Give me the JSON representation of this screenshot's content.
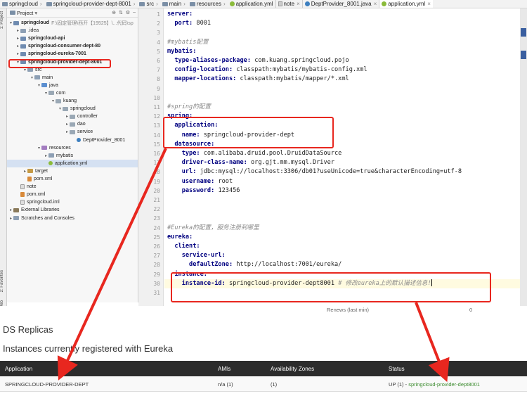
{
  "breadcrumb": [
    "springcloud",
    "springcloud-provider-dept-8001",
    "src",
    "main",
    "resources",
    "application.yml"
  ],
  "tabs": [
    {
      "label": "note",
      "icon": "note-icon"
    },
    {
      "label": "DeptProvider_8001.java",
      "icon": "java-icon"
    },
    {
      "label": "application.yml",
      "icon": "yml-icon",
      "active": true
    }
  ],
  "toolstrip": {
    "project": "1: Project",
    "favorites": "2: Favorites",
    "web": "Web"
  },
  "project_panel": {
    "title": "Project",
    "tree": [
      {
        "label": "springcloud",
        "path": "F:\\固定管理\\西开【19525】\\...代码\\sp",
        "depth": 0,
        "icon": "module",
        "bold": true,
        "arrow": "▾"
      },
      {
        "label": ".idea",
        "depth": 1,
        "icon": "folder",
        "arrow": "▸"
      },
      {
        "label": "springcloud-api",
        "depth": 1,
        "icon": "module",
        "bold": true,
        "arrow": "▸"
      },
      {
        "label": "springcloud-consumer-dept-80",
        "depth": 1,
        "icon": "module",
        "bold": true,
        "arrow": "▸"
      },
      {
        "label": "springcloud-eureka-7001",
        "depth": 1,
        "icon": "module",
        "bold": true,
        "arrow": "▸"
      },
      {
        "label": "springcloud-provider-dept-8001",
        "depth": 1,
        "icon": "module",
        "bold": true,
        "arrow": "▾"
      },
      {
        "label": "src",
        "depth": 2,
        "icon": "folder",
        "arrow": "▾"
      },
      {
        "label": "main",
        "depth": 3,
        "icon": "folder",
        "arrow": "▾"
      },
      {
        "label": "java",
        "depth": 4,
        "icon": "src",
        "arrow": "▾"
      },
      {
        "label": "com",
        "depth": 5,
        "icon": "pkg",
        "arrow": "▾"
      },
      {
        "label": "kuang",
        "depth": 6,
        "icon": "pkg",
        "arrow": "▾"
      },
      {
        "label": "springcloud",
        "depth": 7,
        "icon": "pkg",
        "arrow": "▾"
      },
      {
        "label": "controller",
        "depth": 8,
        "icon": "pkg",
        "arrow": "▸"
      },
      {
        "label": "dao",
        "depth": 8,
        "icon": "pkg",
        "arrow": "▸"
      },
      {
        "label": "service",
        "depth": 8,
        "icon": "pkg",
        "arrow": "▸"
      },
      {
        "label": "DeptProvider_8001",
        "depth": 9,
        "icon": "java",
        "arrow": ""
      },
      {
        "label": "resources",
        "depth": 4,
        "icon": "res",
        "arrow": "▾"
      },
      {
        "label": "mybatis",
        "depth": 5,
        "icon": "folder",
        "arrow": "▸"
      },
      {
        "label": "application.yml",
        "depth": 5,
        "icon": "yml",
        "arrow": "",
        "selected": true
      },
      {
        "label": "target",
        "depth": 2,
        "icon": "target",
        "arrow": "▸"
      },
      {
        "label": "pom.xml",
        "depth": 2,
        "icon": "xml",
        "arrow": ""
      },
      {
        "label": "note",
        "depth": 1,
        "icon": "file",
        "arrow": ""
      },
      {
        "label": "pom.xml",
        "depth": 1,
        "icon": "xml",
        "arrow": ""
      },
      {
        "label": "springcloud.iml",
        "depth": 1,
        "icon": "file",
        "arrow": ""
      },
      {
        "label": "External Libraries",
        "depth": 0,
        "icon": "lib",
        "arrow": "▸"
      },
      {
        "label": "Scratches and Consoles",
        "depth": 0,
        "icon": "folder",
        "arrow": "▸"
      }
    ]
  },
  "editor": {
    "lines": [
      {
        "n": "1",
        "parts": [
          {
            "t": "server:",
            "c": "k"
          }
        ]
      },
      {
        "n": "2",
        "parts": [
          {
            "t": "  port: ",
            "c": "k"
          },
          {
            "t": "8001",
            "c": "v"
          }
        ]
      },
      {
        "n": "3",
        "parts": []
      },
      {
        "n": "4",
        "parts": [
          {
            "t": "#mybatis配置",
            "c": "c"
          }
        ]
      },
      {
        "n": "5",
        "parts": [
          {
            "t": "mybatis:",
            "c": "k"
          }
        ]
      },
      {
        "n": "6",
        "parts": [
          {
            "t": "  type-aliases-package: ",
            "c": "k"
          },
          {
            "t": "com.kuang.springcloud.pojo",
            "c": "v"
          }
        ]
      },
      {
        "n": "7",
        "parts": [
          {
            "t": "  config-location: ",
            "c": "k"
          },
          {
            "t": "classpath:mybatis/mybatis-config.xml",
            "c": "v"
          }
        ]
      },
      {
        "n": "8",
        "parts": [
          {
            "t": "  mapper-locations: ",
            "c": "k"
          },
          {
            "t": "classpath:mybatis/mapper/*.xml",
            "c": "v"
          }
        ]
      },
      {
        "n": "9",
        "parts": []
      },
      {
        "n": "10",
        "parts": []
      },
      {
        "n": "11",
        "parts": [
          {
            "t": "#spring的配置",
            "c": "c"
          }
        ]
      },
      {
        "n": "12",
        "parts": [
          {
            "t": "spring:",
            "c": "k"
          }
        ]
      },
      {
        "n": "13",
        "parts": [
          {
            "t": "  application:",
            "c": "k"
          }
        ]
      },
      {
        "n": "14",
        "parts": [
          {
            "t": "    name: ",
            "c": "k"
          },
          {
            "t": "springcloud-provider-dept",
            "c": "v"
          }
        ]
      },
      {
        "n": "15",
        "parts": [
          {
            "t": "  datasource:",
            "c": "k"
          }
        ]
      },
      {
        "n": "16",
        "parts": [
          {
            "t": "    type: ",
            "c": "k"
          },
          {
            "t": "com.alibaba.druid.pool.DruidDataSource",
            "c": "v"
          }
        ]
      },
      {
        "n": "17",
        "parts": [
          {
            "t": "    driver-class-name: ",
            "c": "k"
          },
          {
            "t": "org.gjt.mm.mysql.Driver",
            "c": "v"
          }
        ]
      },
      {
        "n": "18",
        "parts": [
          {
            "t": "    url: ",
            "c": "k"
          },
          {
            "t": "jdbc:mysql://localhost:3306/db01?useUnicode=true&characterEncoding=utf-8",
            "c": "v"
          }
        ]
      },
      {
        "n": "19",
        "parts": [
          {
            "t": "    username: ",
            "c": "k"
          },
          {
            "t": "root",
            "c": "v"
          }
        ]
      },
      {
        "n": "20",
        "parts": [
          {
            "t": "    password: ",
            "c": "k"
          },
          {
            "t": "123456",
            "c": "v"
          }
        ]
      },
      {
        "n": "21",
        "parts": []
      },
      {
        "n": "22",
        "parts": []
      },
      {
        "n": "23",
        "parts": []
      },
      {
        "n": "24",
        "parts": [
          {
            "t": "#Eureka的配置，服务注册到哪里",
            "c": "c"
          }
        ]
      },
      {
        "n": "25",
        "parts": [
          {
            "t": "eureka:",
            "c": "k"
          }
        ]
      },
      {
        "n": "26",
        "parts": [
          {
            "t": "  client:",
            "c": "k"
          }
        ]
      },
      {
        "n": "27",
        "parts": [
          {
            "t": "    service-url:",
            "c": "k"
          }
        ]
      },
      {
        "n": "28",
        "parts": [
          {
            "t": "      defaultZone: ",
            "c": "k"
          },
          {
            "t": "http://localhost:7001/eureka/",
            "c": "v"
          }
        ]
      },
      {
        "n": "29",
        "parts": [
          {
            "t": "  instance:",
            "c": "k"
          }
        ]
      },
      {
        "n": "30",
        "parts": [
          {
            "t": "    instance-id: ",
            "c": "k"
          },
          {
            "t": "springcloud-provider-dept8001 ",
            "c": "v"
          },
          {
            "t": "# 修改eureka上的默认描述信息!",
            "c": "c"
          }
        ]
      },
      {
        "n": "31",
        "parts": []
      }
    ]
  },
  "eureka": {
    "renews_label": "Renews (last min)",
    "renews_value": "0",
    "ds_replicas": "DS Replicas",
    "instances_title": "Instances currently registered with Eureka",
    "columns": [
      "Application",
      "AMIs",
      "Availability Zones",
      "Status"
    ],
    "row": {
      "application": "SPRINGCLOUD-PROVIDER-DEPT",
      "amis": "n/a (1)",
      "zones": "(1)",
      "status_prefix": "UP (1) - ",
      "status_link": "springcloud-provider-dept8001"
    }
  },
  "colors": {
    "annotation_red": "#e8271f",
    "yaml_key": "#000080",
    "comment": "#8a8a8a",
    "link_green": "#3b8b2e"
  }
}
